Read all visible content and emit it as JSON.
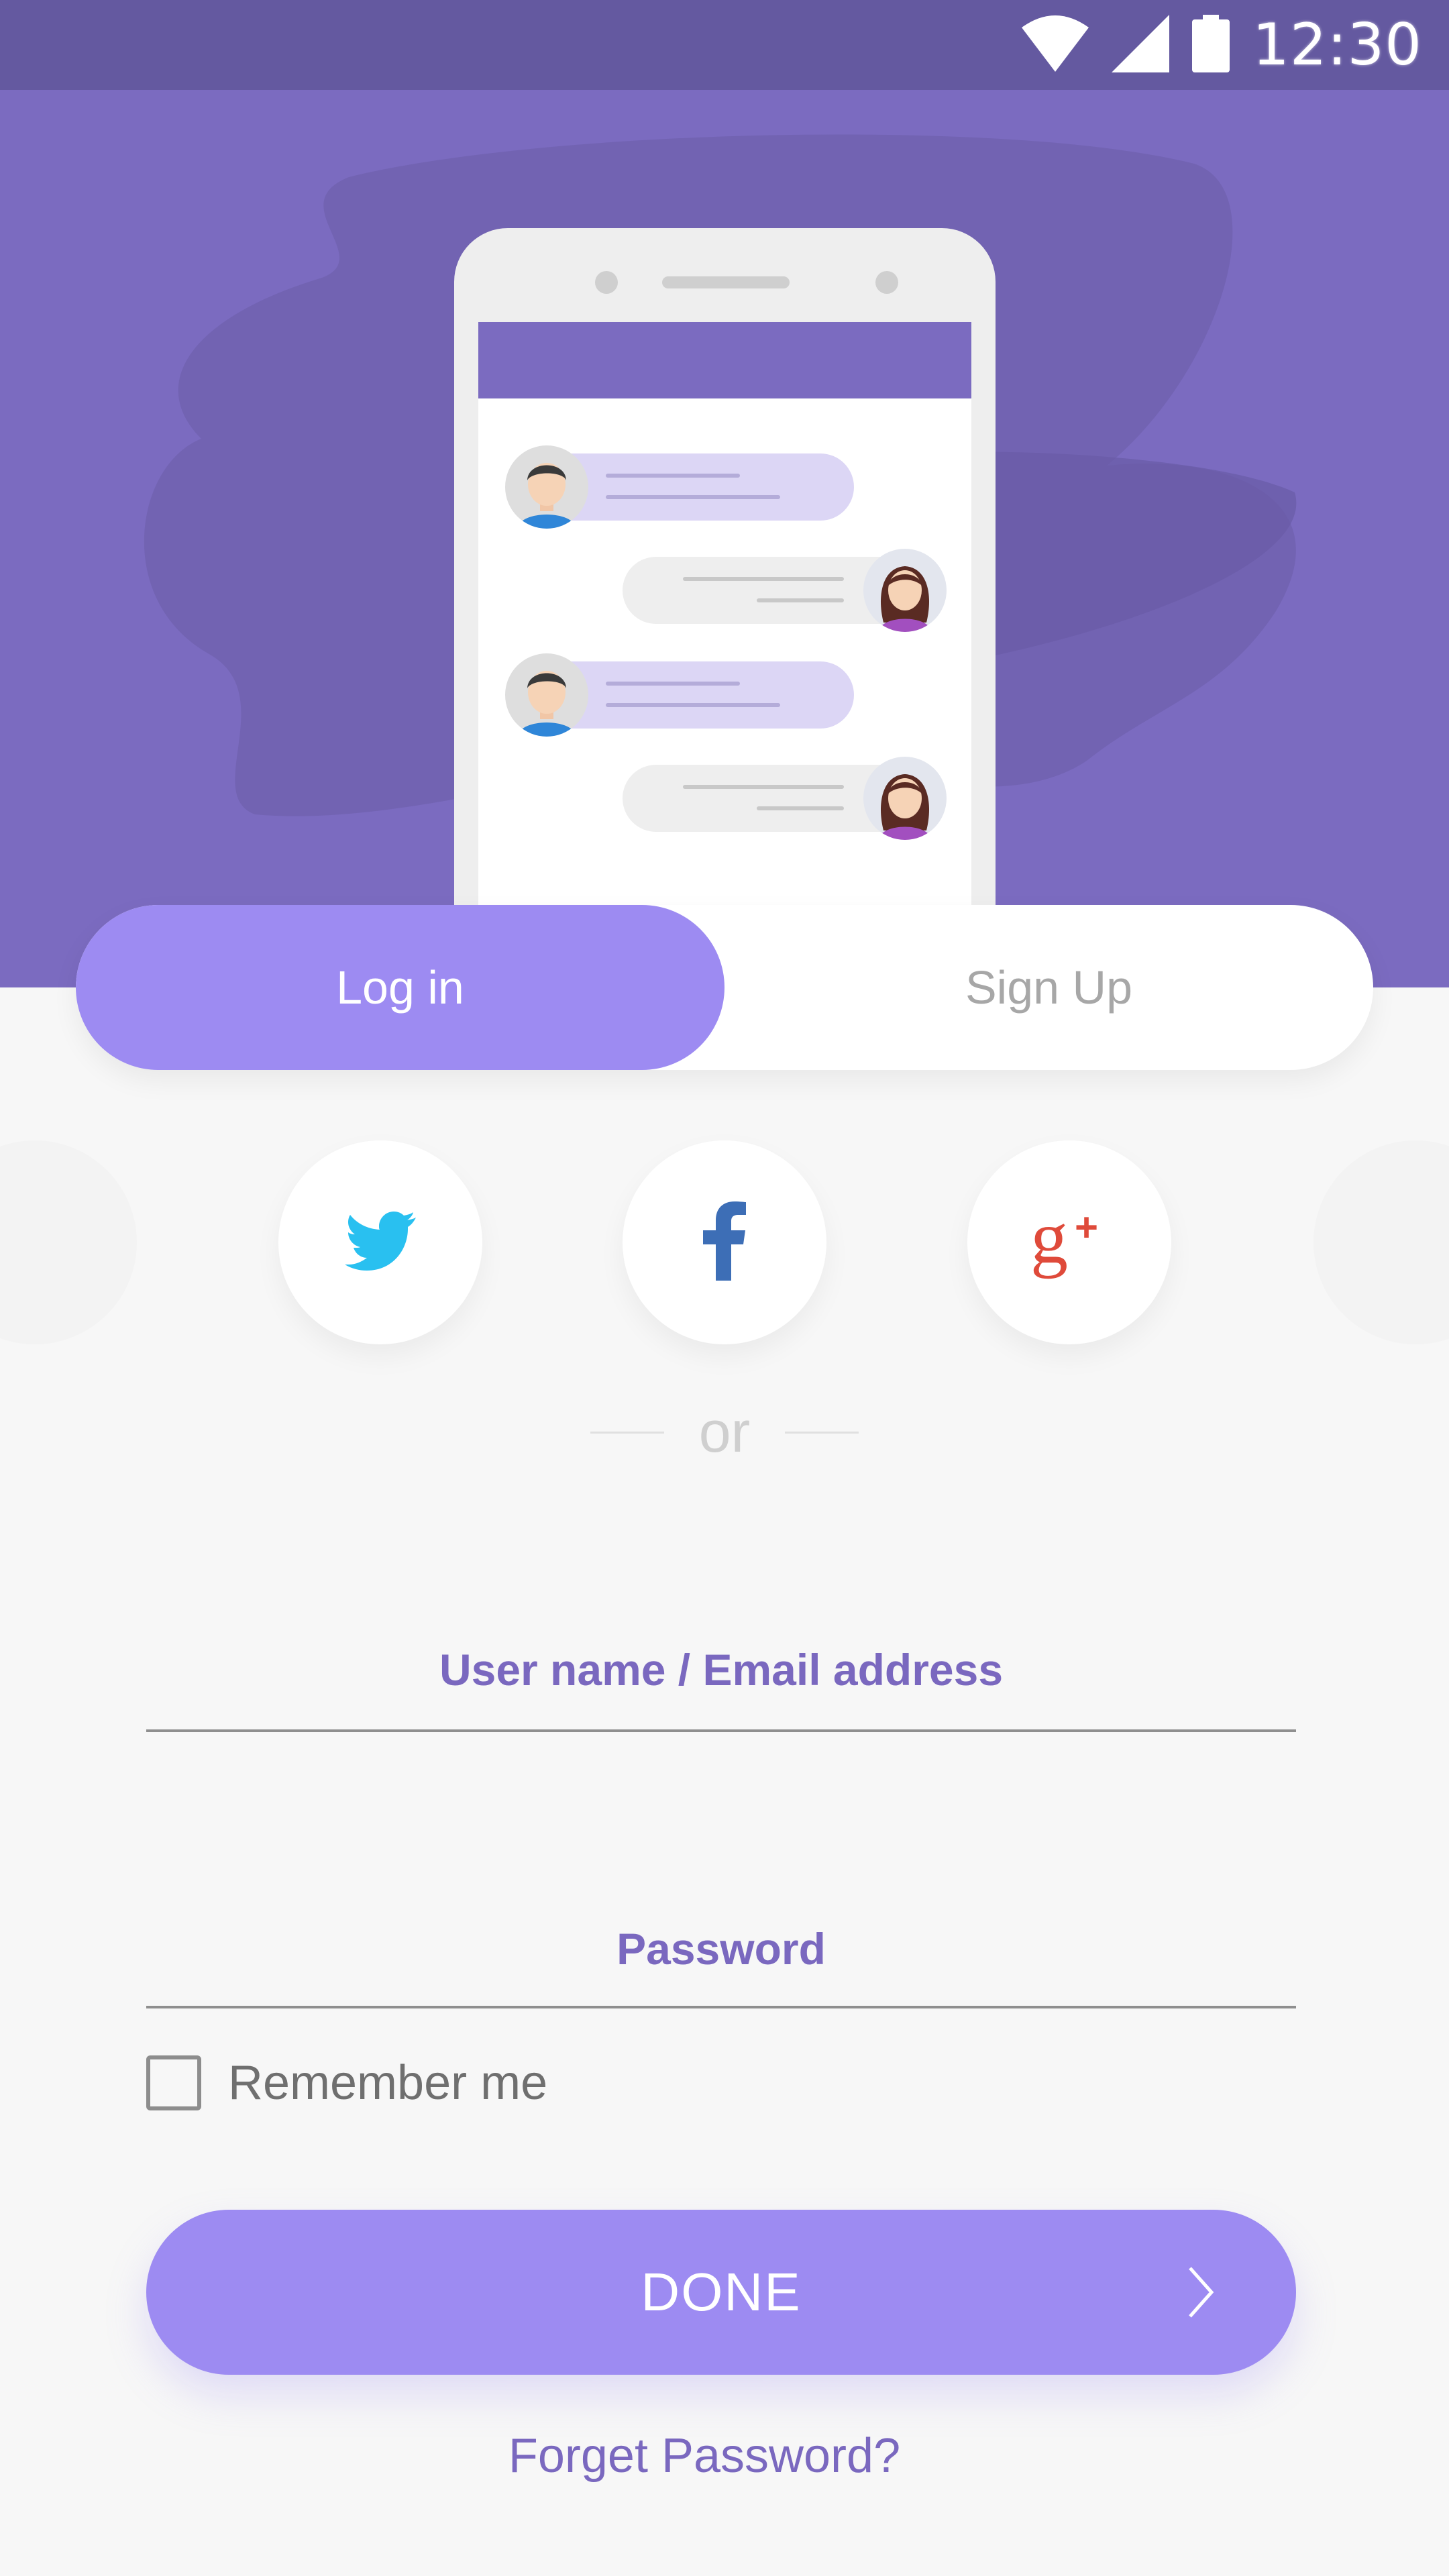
{
  "status_bar": {
    "time": "12:30"
  },
  "auth_tabs": {
    "login_label": "Log in",
    "signup_label": "Sign Up",
    "active": "login"
  },
  "social": [
    "twitter-icon",
    "facebook-icon",
    "google-plus-icon"
  ],
  "divider": {
    "text": "or"
  },
  "form": {
    "username_placeholder": "User name / Email address",
    "username_value": "",
    "password_placeholder": "Password",
    "password_value": "",
    "remember_label": "Remember me",
    "remember_checked": false
  },
  "done_button": {
    "label": "DONE"
  },
  "forget_link": {
    "label": "Forget Password?"
  },
  "colors": {
    "status_bar": "#6459a0",
    "hero": "#7b6bc0",
    "accent": "#9d8bf2",
    "text_accent": "#7a68bf",
    "background": "#f7f7f7"
  }
}
